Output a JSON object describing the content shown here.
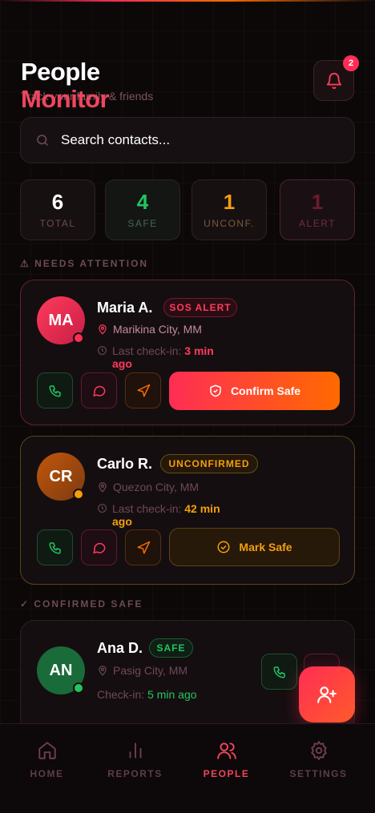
{
  "header": {
    "title_line1": "People",
    "title_line2": "Monitor",
    "subtitle": "Track your family & friends",
    "notifications_count": "2"
  },
  "search": {
    "placeholder": "Search contacts..."
  },
  "stats": [
    {
      "value": "6",
      "label": "TOTAL"
    },
    {
      "value": "4",
      "label": "SAFE"
    },
    {
      "value": "1",
      "label": "UNCONF."
    },
    {
      "value": "1",
      "label": "ALERT"
    }
  ],
  "sections": {
    "attention": "⚠ NEEDS ATTENTION",
    "safe": "✓ CONFIRMED SAFE"
  },
  "contacts": [
    {
      "initials": "MA",
      "name": "Maria A.",
      "status": "SOS ALERT",
      "location": "Marikina City, MM",
      "checkin_label": "Last check-in: ",
      "checkin_value": "3 min ago",
      "action_label": "Confirm Safe"
    },
    {
      "initials": "CR",
      "name": "Carlo R.",
      "status": "UNCONFIRMED",
      "location": "Quezon City, MM",
      "checkin_label": "Last check-in: ",
      "checkin_value": "42 min ago",
      "action_label": "Mark Safe"
    },
    {
      "initials": "AN",
      "name": "Ana D.",
      "status": "SAFE",
      "location": "Pasig City, MM",
      "checkin_label": "Check-in: ",
      "checkin_value": "5 min ago"
    }
  ],
  "nav": [
    {
      "label": "HOME"
    },
    {
      "label": "REPORTS"
    },
    {
      "label": "PEOPLE"
    },
    {
      "label": "SETTINGS"
    }
  ],
  "colors": {
    "accent": "#ff2d55",
    "accent_orange": "#ff6a00",
    "safe": "#22c55e",
    "warning": "#f59e0b",
    "background": "#0c0808"
  },
  "icons": {
    "bell": "bell-icon",
    "search": "search-icon",
    "pin": "map-pin-icon",
    "clock": "clock-icon",
    "call": "phone-icon",
    "message": "message-icon",
    "navigate": "navigation-icon",
    "shield": "shield-check-icon",
    "check": "check-circle-icon",
    "add_user": "user-plus-icon",
    "home": "home-icon",
    "reports": "bar-chart-icon",
    "people": "users-icon",
    "settings": "gear-icon"
  }
}
